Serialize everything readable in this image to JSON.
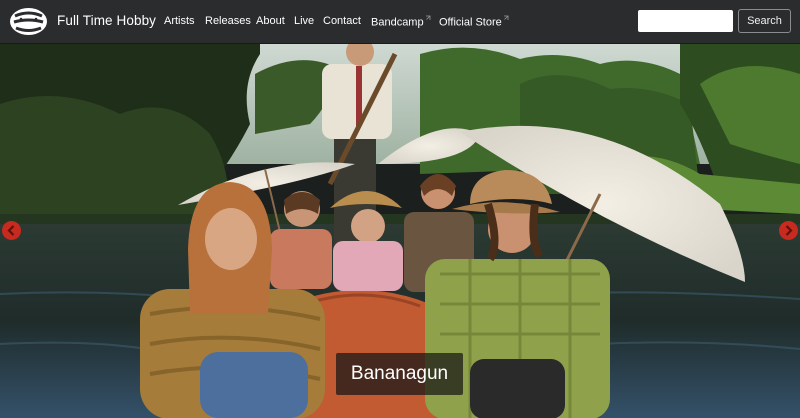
{
  "header": {
    "brand": "Full Time Hobby",
    "logo_text": "Full Time Hobby",
    "nav": [
      {
        "label": "Artists"
      },
      {
        "label": "Releases"
      },
      {
        "label": "About"
      },
      {
        "label": "Live"
      },
      {
        "label": "Contact"
      },
      {
        "label": "Bandcamp",
        "external": true,
        "icon": "external-link-icon"
      },
      {
        "label": "Official Store",
        "external": true,
        "icon": "external-link-icon"
      }
    ],
    "search": {
      "value": "",
      "button_label": "Search"
    }
  },
  "hero": {
    "caption": "Bananagun",
    "prev_icon": "chevron-left-icon",
    "next_icon": "chevron-right-icon",
    "arrow_color": "#c72a1f"
  },
  "colors": {
    "navbar_bg": "#2b2c2e",
    "text": "#ffffff"
  }
}
